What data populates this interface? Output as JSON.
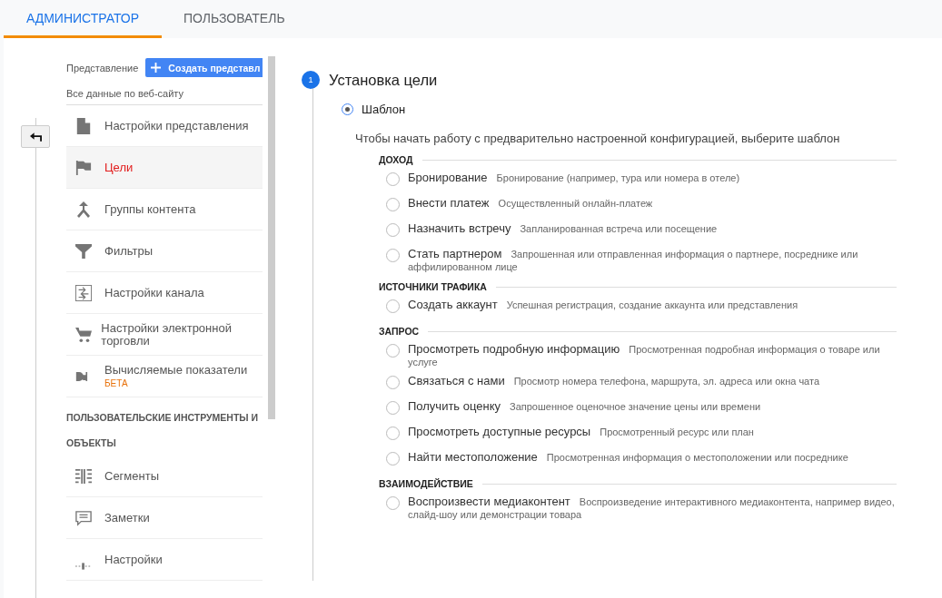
{
  "tabs": [
    {
      "label": "АДМИНИСТРАТОР",
      "selected": true
    },
    {
      "label": "ПОЛЬЗОВАТЕЛЬ",
      "selected": false
    }
  ],
  "sidebar": {
    "view_label": "Представление",
    "create_button": "Создать представл",
    "view_name": "Все данные по веб-сайту",
    "items": [
      {
        "label": "Настройки представления",
        "selected": false
      },
      {
        "label": "Цели",
        "selected": true
      },
      {
        "label": "Группы контента",
        "selected": false
      },
      {
        "label": "Фильтры",
        "selected": false
      },
      {
        "label": "Настройки канала",
        "selected": false
      },
      {
        "label": "Настройки электронной торговли",
        "selected": false
      },
      {
        "label": "Вычисляемые показатели",
        "badge": "БЕТА",
        "selected": false
      }
    ],
    "section": "ПОЛЬЗОВАТЕЛЬСКИЕ ИНСТРУМЕНТЫ И ОБЪЕКТЫ",
    "tools": [
      {
        "label": "Сегменты",
        "selected": false
      },
      {
        "label": "Заметки",
        "selected": false
      },
      {
        "label": "Настройки",
        "selected": false
      }
    ]
  },
  "step": {
    "number": "1",
    "title": "Установка цели",
    "template": {
      "label": "Шаблон",
      "selected": true
    },
    "hint": "Чтобы начать работу с предварительно настроенной конфигурацией, выберите шаблон",
    "groups": [
      {
        "title": "ДОХОД",
        "options": [
          {
            "label": "Бронирование",
            "description": "Бронирование (например, тура или номера в отеле)",
            "selected": false
          },
          {
            "label": "Внести платеж",
            "description": "Осуществленный онлайн-платеж",
            "selected": false
          },
          {
            "label": "Назначить встречу",
            "description": "Запланированная встреча или посещение",
            "selected": false
          },
          {
            "label": "Стать партнером",
            "description": "Запрошенная или отправленная информация о партнере, посреднике или аффилированном лице",
            "selected": false
          }
        ]
      },
      {
        "title": "ИСТОЧНИКИ ТРАФИКА",
        "options": [
          {
            "label": "Создать аккаунт",
            "description": "Успешная регистрация, создание аккаунта или представления",
            "selected": false
          }
        ]
      },
      {
        "title": "ЗАПРОС",
        "options": [
          {
            "label": "Просмотреть подробную информацию",
            "description": "Просмотренная подробная информация о товаре или услуге",
            "selected": false
          },
          {
            "label": "Связаться с нами",
            "description": "Просмотр номера телефона, маршрута, эл. адреса или окна чата",
            "selected": false
          },
          {
            "label": "Получить оценку",
            "description": "Запрошенное оценочное значение цены или времени",
            "selected": false
          },
          {
            "label": "Просмотреть доступные ресурсы",
            "description": "Просмотренный ресурс или план",
            "selected": false
          },
          {
            "label": "Найти местоположение",
            "description": "Просмотренная информация о местоположении или посреднике",
            "selected": false
          }
        ]
      },
      {
        "title": "ВЗАИМОДЕЙСТВИЕ",
        "options": [
          {
            "label": "Воспроизвести медиаконтент",
            "description": "Воспроизведение интерактивного медиаконтента, например видео, слайд-шоу или демонстрации товара",
            "selected": false
          }
        ]
      }
    ]
  }
}
